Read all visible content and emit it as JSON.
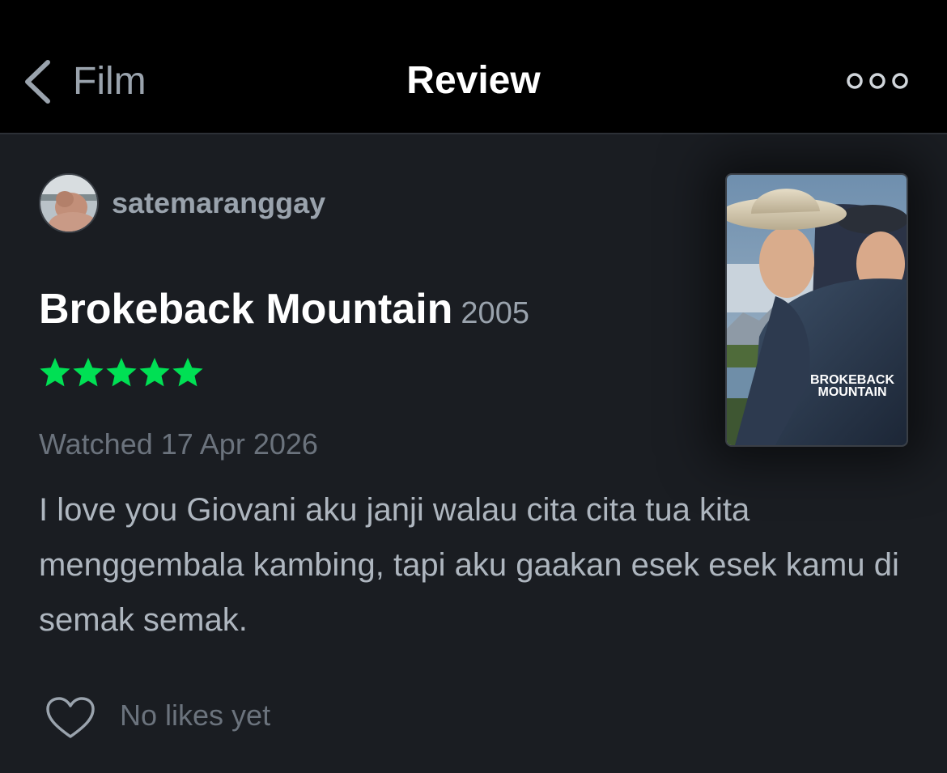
{
  "header": {
    "back_label": "Film",
    "title": "Review"
  },
  "review": {
    "username": "satemaranggay",
    "film_title": "Brokeback Mountain",
    "film_year": "2005",
    "rating": 5,
    "watched": "Watched 17 Apr 2026",
    "text": "I love you Giovani aku janji walau cita cita tua kita menggembala kambing, tapi aku gaakan esek esek kamu di semak semak.",
    "likes": "No likes yet",
    "poster_title_line1": "BROKEBACK",
    "poster_title_line2": "MOUNTAIN"
  },
  "colors": {
    "star": "#00e054",
    "background": "#1a1d22",
    "header": "#000000"
  }
}
